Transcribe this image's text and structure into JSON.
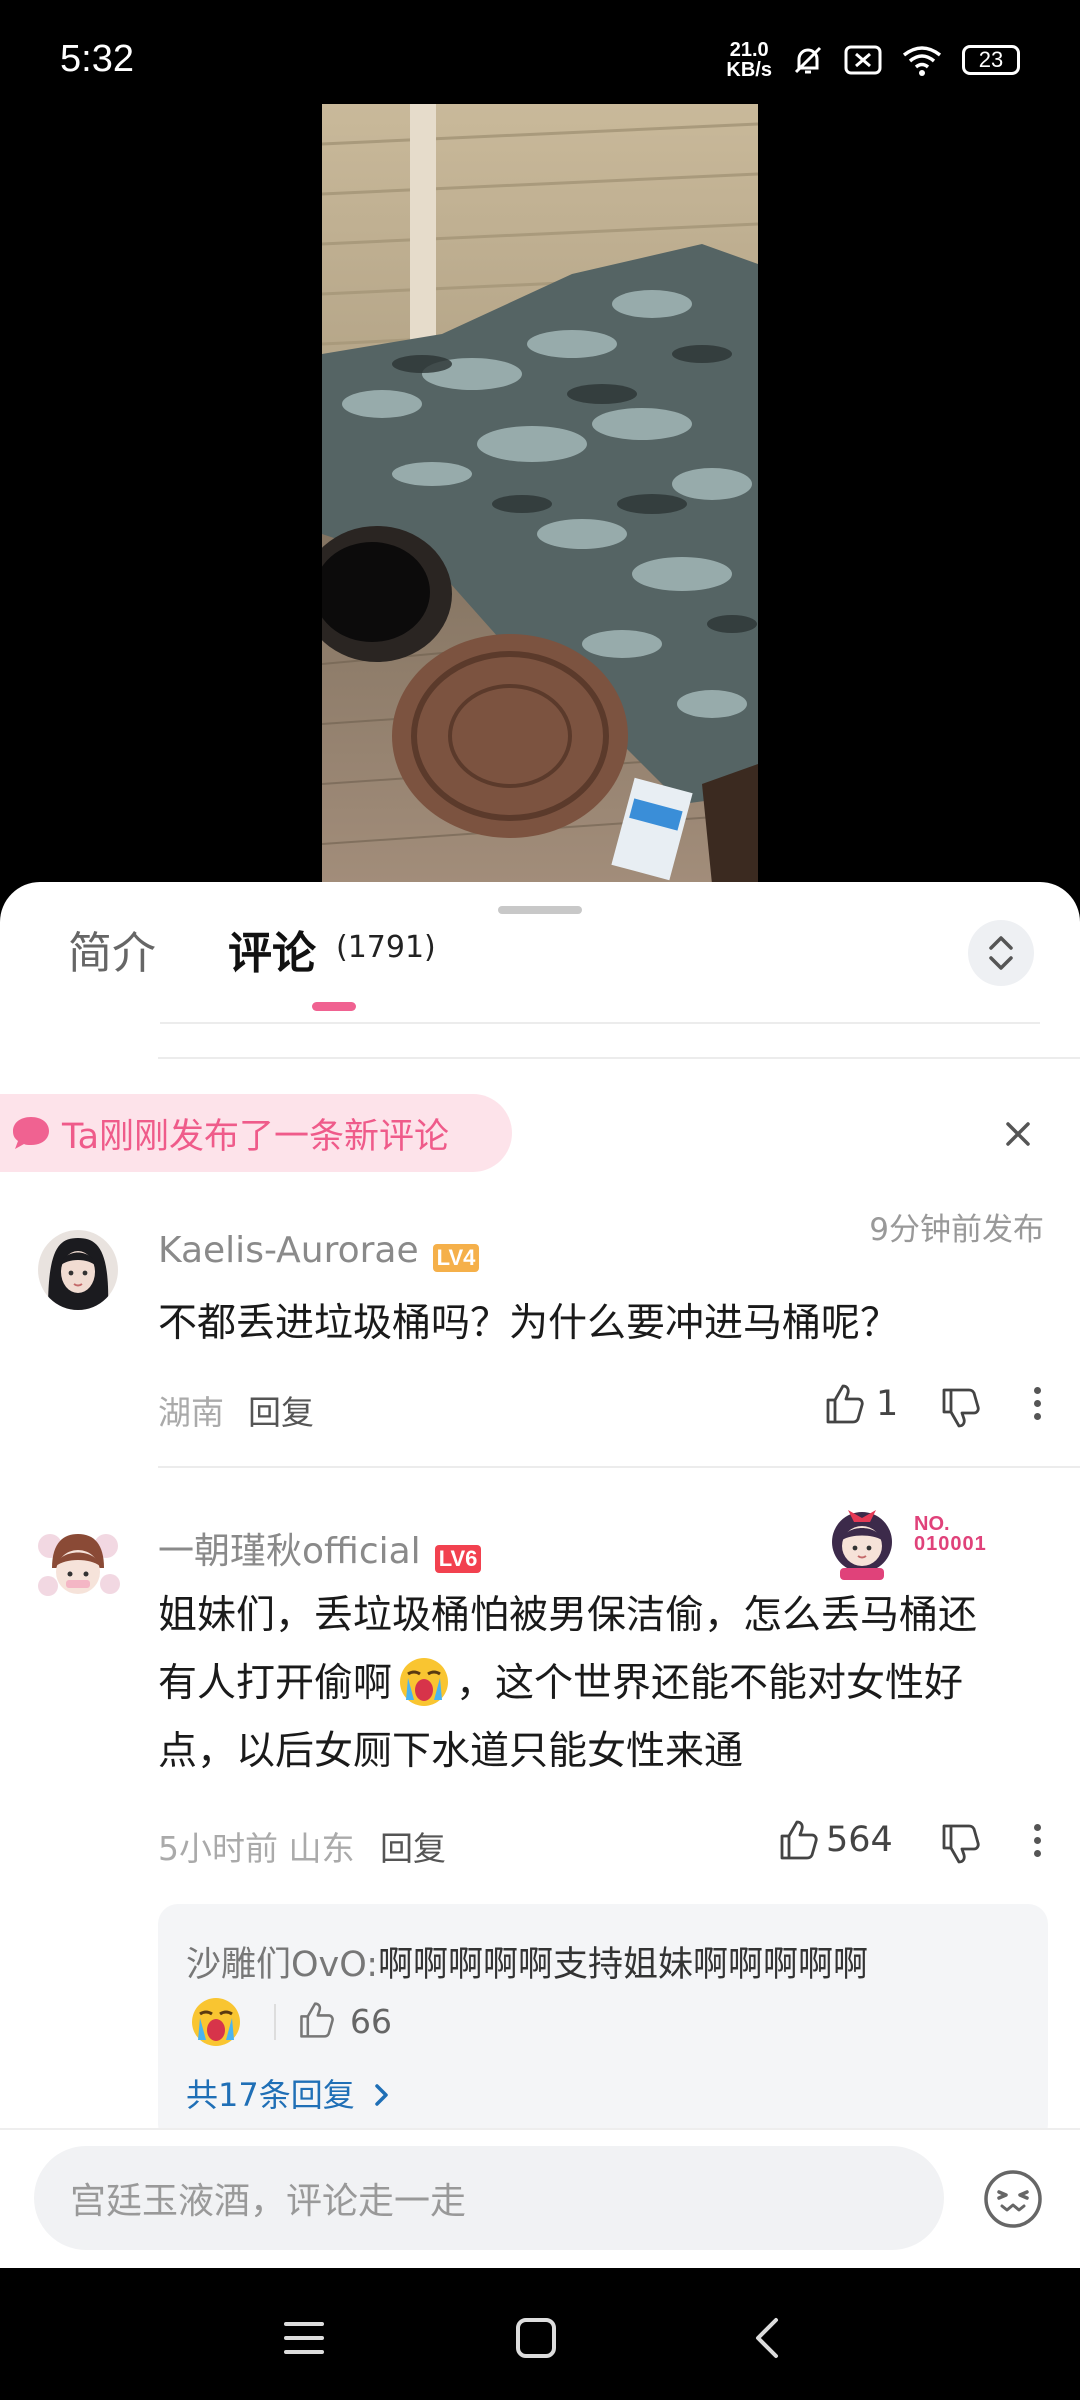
{
  "status_bar": {
    "time": "5:32",
    "net_speed_value": "21.0",
    "net_speed_unit": "KB/s",
    "battery": "23",
    "icons": [
      "bell-muted-icon",
      "sim-off-icon",
      "wifi-icon",
      "battery-icon"
    ]
  },
  "video": {
    "watermark": ""
  },
  "tabs": {
    "intro": "简介",
    "comments": "评论",
    "comments_count": "(1791)"
  },
  "new_comment_banner": {
    "text": "Ta刚刚发布了一条新评论"
  },
  "comments": [
    {
      "username": "Kaelis-Aurorae",
      "level": "LV4",
      "posted": "9分钟前发布",
      "text": "不都丢进垃圾桶吗？为什么要冲进马桶呢？",
      "location": "湖南",
      "reply_label": "回复",
      "likes": "1"
    },
    {
      "username": "一朝瑾秋official",
      "level": "LV6",
      "badge_no": "NO.",
      "badge_num": "010001",
      "text_line1": "姐妹们，丢垃圾桶怕被男保洁偷，怎么丢马桶还",
      "text_line2a": "有人打开偷啊",
      "text_line2b": "，这个世界还能不能对女性好",
      "text_line3": "点，以后女厕下水道只能女性来通",
      "time": "5小时前",
      "location": "山东",
      "reply_label": "回复",
      "likes": "564"
    }
  ],
  "reply_preview": {
    "author": "沙雕们OvO:",
    "text": "啊啊啊啊啊支持姐妹啊啊啊啊啊",
    "likes": "66",
    "total": "共17条回复"
  },
  "input": {
    "placeholder": "宫廷玉液酒，评论走一走"
  },
  "colors": {
    "accent_pink": "#f06291",
    "link_blue": "#1f6fb6",
    "lv4": "#f5b04a",
    "lv6": "#f2414f"
  }
}
